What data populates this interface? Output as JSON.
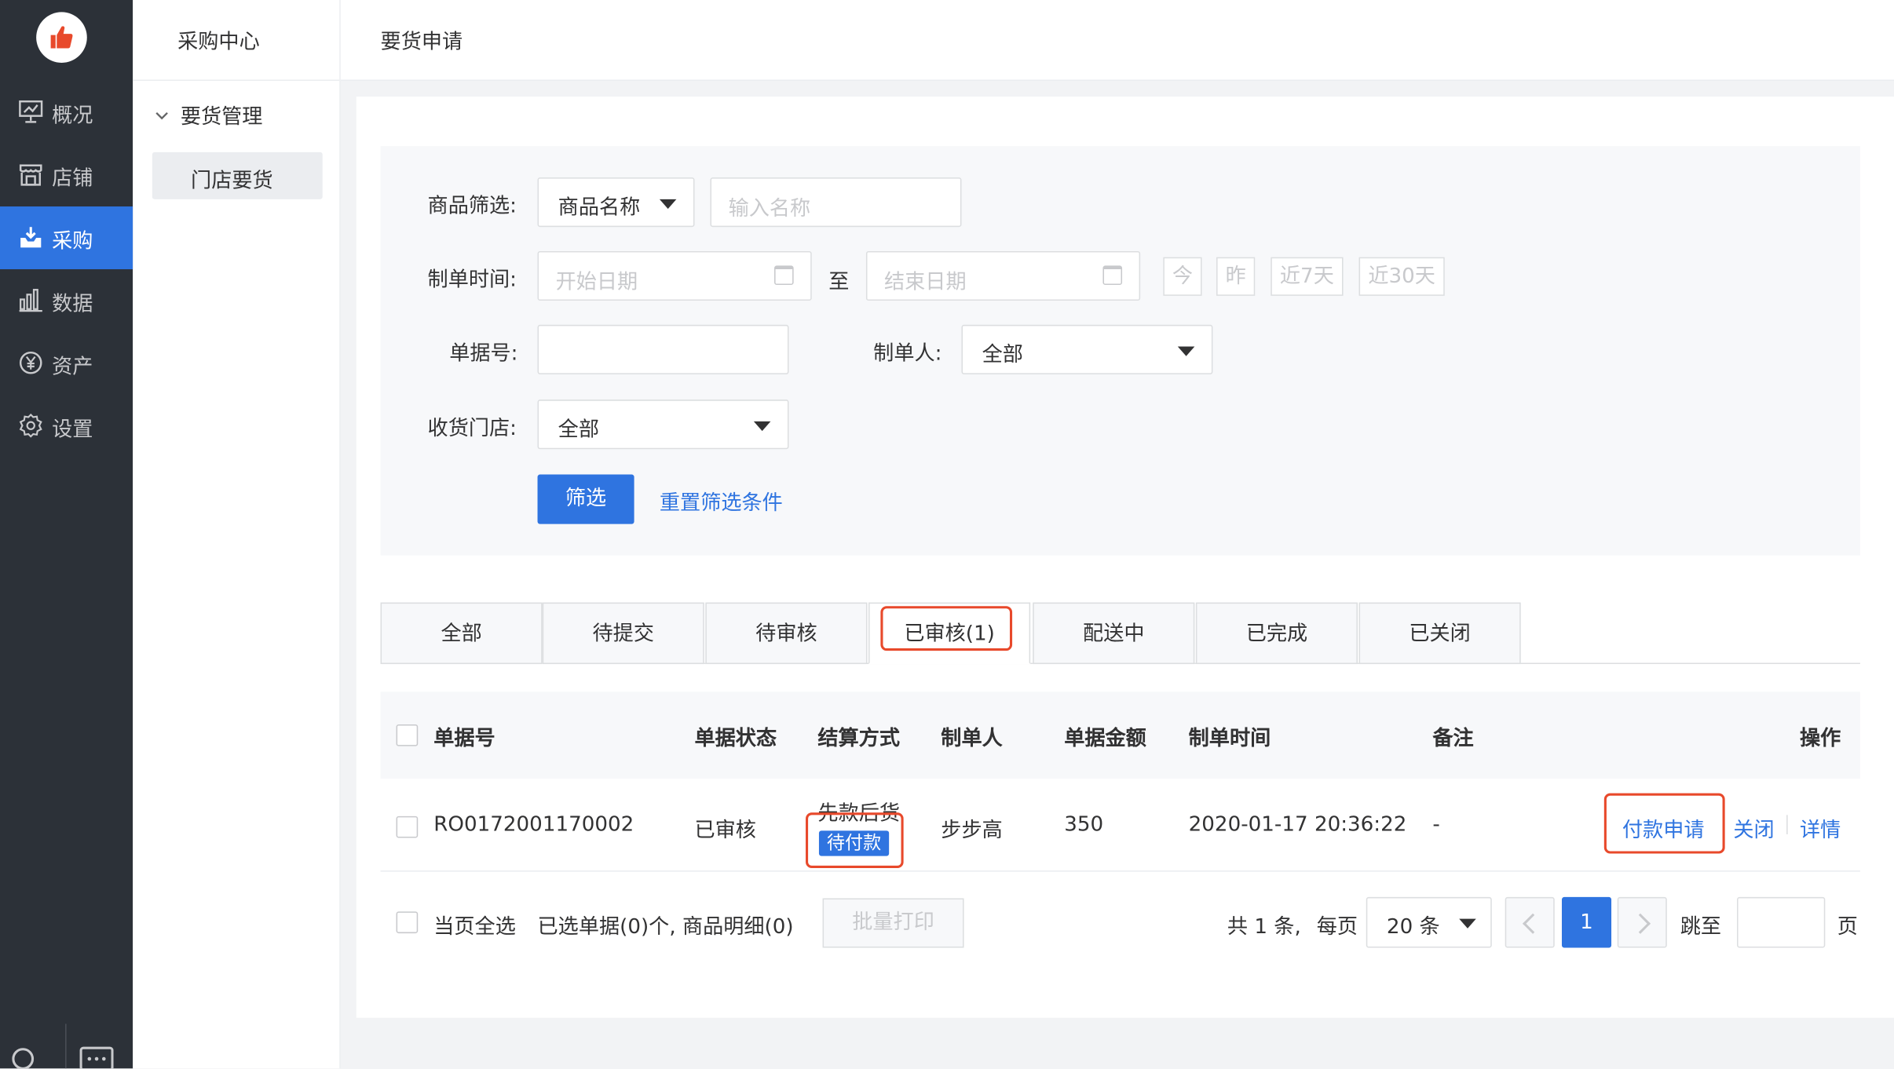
{
  "nav": {
    "items": [
      {
        "label": "概况",
        "icon": "overview-icon"
      },
      {
        "label": "店铺",
        "icon": "store-icon"
      },
      {
        "label": "采购",
        "icon": "purchase-icon"
      },
      {
        "label": "数据",
        "icon": "data-icon"
      },
      {
        "label": "资产",
        "icon": "asset-icon"
      },
      {
        "label": "设置",
        "icon": "settings-icon"
      }
    ],
    "active": "采购",
    "accent": "#2f74e0"
  },
  "sidebar": {
    "title": "采购中心",
    "group": "要货管理",
    "item": "门店要货"
  },
  "header": {
    "title": "要货申请"
  },
  "filter": {
    "product_label": "商品筛选:",
    "product_type": "商品名称",
    "product_placeholder": "输入名称",
    "date_label": "制单时间:",
    "start_placeholder": "开始日期",
    "to": "至",
    "end_placeholder": "结束日期",
    "quick": [
      "今",
      "昨",
      "近7天",
      "近30天"
    ],
    "doc_no_label": "单据号:",
    "creator_label": "制单人:",
    "creator_value": "全部",
    "store_label": "收货门店:",
    "store_value": "全部",
    "submit": "筛选",
    "reset": "重置筛选条件"
  },
  "tabs": {
    "items": [
      "全部",
      "待提交",
      "待审核",
      "已审核(1)",
      "配送中",
      "已完成",
      "已关闭"
    ],
    "active": "已审核(1)"
  },
  "table": {
    "headers": [
      "单据号",
      "单据状态",
      "结算方式",
      "制单人",
      "单据金额",
      "制单时间",
      "备注",
      "操作"
    ],
    "rows": [
      {
        "doc_no": "RO0172001170002",
        "status": "已审核",
        "settle": "先款后货",
        "settle_badge": "待付款",
        "creator": "步步高",
        "amount": "350",
        "time": "2020-01-17 20:36:22",
        "remark": "-",
        "actions": [
          "付款申请",
          "关闭",
          "详情"
        ]
      }
    ]
  },
  "footer": {
    "select_all": "当页全选",
    "selected": "已选单据(0)个, 商品明细(0)",
    "batch_print": "批量打印",
    "total": "共 1 条,",
    "per_page_label": "每页",
    "per_page": "20 条",
    "current_page": "1",
    "jump_label": "跳至",
    "page_unit": "页"
  },
  "highlight_color": "#e8492b"
}
